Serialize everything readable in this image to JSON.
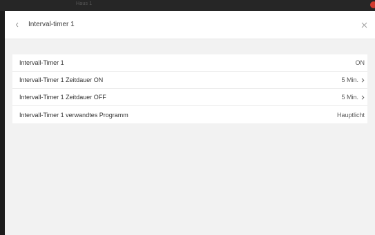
{
  "background_window": {
    "title": "Haus 1"
  },
  "dialog": {
    "title": "Interval-timer 1",
    "back_icon": "chevron-left-icon",
    "close_icon": "close-icon"
  },
  "rows": [
    {
      "label": "Intervall-Timer 1",
      "value": "ON",
      "has_chevron": false
    },
    {
      "label": "Intervall-Timer 1 Zeitdauer ON",
      "value": "5 Min.",
      "has_chevron": true
    },
    {
      "label": "Intervall-Timer 1 Zeitdauer OFF",
      "value": "5 Min.",
      "has_chevron": true
    },
    {
      "label": "Intervall-Timer 1 verwandtes Programm",
      "value": "Hauptlicht",
      "has_chevron": false
    }
  ],
  "colors": {
    "accent_notification": "#d23a2f",
    "dialog_background": "#f2f2f2",
    "card_background": "#ffffff"
  }
}
